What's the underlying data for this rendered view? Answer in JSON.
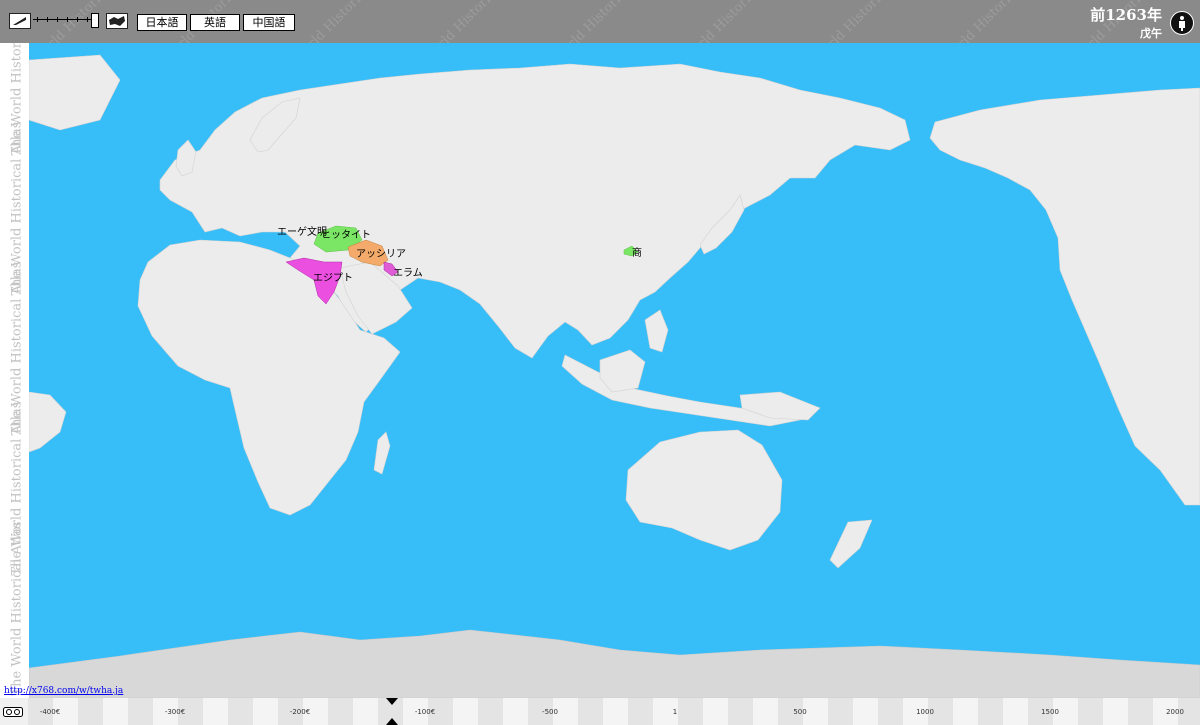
{
  "toolbar": {
    "watermark": "The World Historical Atlas",
    "languages": [
      "日本語",
      "英語",
      "中国語"
    ],
    "year": "前1263年",
    "cycle": "戊午"
  },
  "map": {
    "labels": {
      "aegean": "エーゲ文明",
      "hittite": "ヒッタイト",
      "assyria": "アッシリア",
      "egypt": "エジプト",
      "elam": "エラム",
      "shang": "商"
    },
    "colors": {
      "ocean": "#37bef8",
      "land": "#ececec",
      "ice": "#d8d8d8",
      "aegean": "#37bef8",
      "hittite": "#7be665",
      "assyria": "#f3aa6a",
      "egypt": "#ea4fe0",
      "elam": "#e05bd6",
      "shang": "#7be665"
    }
  },
  "timeline": {
    "labels": [
      "-400€",
      "-300€",
      "-200€",
      "-100€",
      "-500",
      "1",
      "500",
      "1000",
      "1500",
      "2000"
    ]
  },
  "footer": {
    "link": "http://x768.com/w/twha.ja"
  }
}
